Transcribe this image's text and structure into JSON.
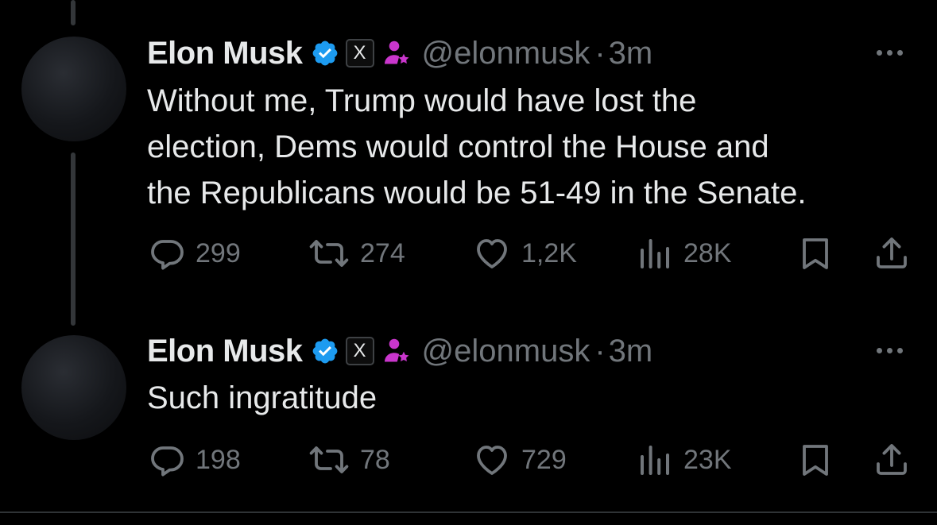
{
  "tweets": [
    {
      "author": {
        "name": "Elon Musk",
        "badge_label": "X",
        "handle": "@elonmusk"
      },
      "separator": "·",
      "time": "3m",
      "text": "Without me, Trump would have lost the election, Dems would control the House and the Republicans would be 51-49 in the Senate.",
      "text_lines": [
        "Without me, Trump would have lost the",
        "election, Dems would control the House and",
        "the Republicans would be 51-49 in the Senate."
      ],
      "stats": {
        "replies": "299",
        "reposts": "274",
        "likes": "1,2K",
        "views": "28K"
      }
    },
    {
      "author": {
        "name": "Elon Musk",
        "badge_label": "X",
        "handle": "@elonmusk"
      },
      "separator": "·",
      "time": "3m",
      "text": "Such ingratitude",
      "text_lines": [
        "Such ingratitude"
      ],
      "stats": {
        "replies": "198",
        "reposts": "78",
        "likes": "729",
        "views": "23K"
      }
    }
  ],
  "icons": {
    "verified": "verified-badge-icon",
    "affiliation": "affiliation-icon",
    "reply": "reply-icon",
    "repost": "repost-icon",
    "like": "like-icon",
    "views": "views-icon",
    "bookmark": "bookmark-icon",
    "share": "share-icon",
    "more": "more-icon"
  },
  "colors": {
    "background": "#000000",
    "text": "#e7e9ea",
    "secondary": "#71767b",
    "verified": "#1d9bf0",
    "affiliation": "#c936cc",
    "thread_line": "#333639"
  }
}
